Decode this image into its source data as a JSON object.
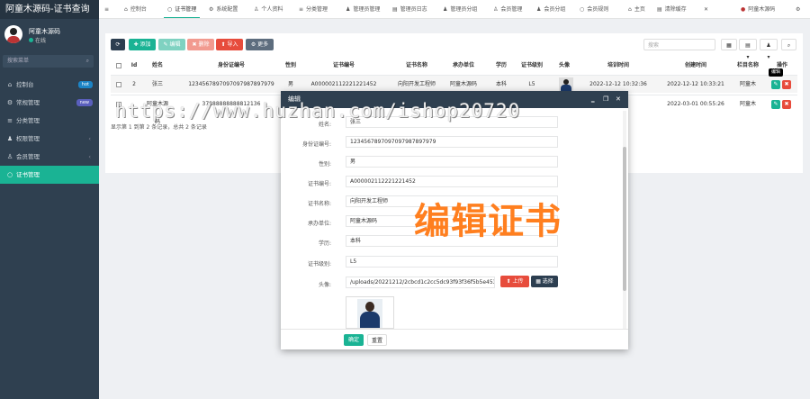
{
  "app_title": "阿童木源码-证书查询",
  "user": {
    "name": "阿童木源码",
    "status": "在线"
  },
  "sidebar": {
    "search_placeholder": "搜索菜单",
    "items": [
      {
        "label": "控制台",
        "icon": "⌂",
        "badge": "hot",
        "badge_color": "#1c84c6"
      },
      {
        "label": "常规管理",
        "icon": "⚙",
        "badge": "new",
        "badge_color": "#5a5fbd"
      },
      {
        "label": "分类管理",
        "icon": "≡"
      },
      {
        "label": "权限管理",
        "icon": "♟",
        "arrow": "‹"
      },
      {
        "label": "会员管理",
        "icon": "♙",
        "arrow": "‹"
      },
      {
        "label": "证书管理",
        "icon": "○"
      }
    ]
  },
  "topnav": [
    {
      "label": "",
      "icon": "≡"
    },
    {
      "label": "控制台",
      "icon": "⌂"
    },
    {
      "label": "证书管理",
      "icon": "○"
    },
    {
      "label": "系统配置",
      "icon": "⚙"
    },
    {
      "label": "个人资料",
      "icon": "♙"
    },
    {
      "label": "分类管理",
      "icon": "≡"
    },
    {
      "label": "管理员管理",
      "icon": "♟"
    },
    {
      "label": "管理员日志",
      "icon": "▤"
    },
    {
      "label": "管理员分组",
      "icon": "♟"
    },
    {
      "label": "会员管理",
      "icon": "♙"
    },
    {
      "label": "会员分组",
      "icon": "♟"
    },
    {
      "label": "会员规则",
      "icon": "○"
    },
    {
      "label": "主页",
      "icon": "⌂"
    },
    {
      "label": "清除缓存",
      "icon": "▤"
    },
    {
      "label": "",
      "icon": "✕"
    },
    {
      "label": "阿童木源码",
      "icon": "●"
    },
    {
      "label": "",
      "icon": "⚙"
    }
  ],
  "toolbar": {
    "refresh": "⟳",
    "add": "✚ 添加",
    "edit": "✎ 编辑",
    "delete": "✖ 删除",
    "import": "⬆ 导入",
    "more": "⚙ 更多",
    "search_placeholder": "搜索",
    "view_icons": [
      "▦",
      "▤ ▾",
      "♟ ▾",
      "⌕"
    ]
  },
  "table": {
    "headers": [
      "",
      "Id",
      "姓名",
      "身份证编号",
      "性别",
      "证书编号",
      "证书名称",
      "承办单位",
      "学历",
      "证书级别",
      "头像",
      "培训时间",
      "创建时间",
      "栏目名称",
      "操作"
    ],
    "rows": [
      {
        "id": "2",
        "name": "张三",
        "idno": "1234567897097097987897979",
        "gender": "男",
        "certno": "A000002112221221452",
        "certname": "向阳开发工程师",
        "org": "阿童木源码",
        "edu": "本科",
        "level": "L5",
        "train": "2022-12-12 10:32:36",
        "created": "2022-12-12 10:33:21",
        "column": "阿童木"
      },
      {
        "id": "",
        "name": "阿童木源码",
        "idno": "37888888888812136",
        "gender": "",
        "certno": "",
        "certname": "",
        "org": "",
        "edu": "",
        "level": "",
        "train": "",
        "created": "2022-03-01 00:55:26",
        "column": "阿童木"
      }
    ],
    "footer": "显示第 1 到第 2 条记录，总共 2 条记录",
    "tooltip": "编辑"
  },
  "modal": {
    "title": "编辑",
    "fields": [
      {
        "label": "姓名:",
        "value": "张三"
      },
      {
        "label": "身份证编号:",
        "value": "1234567897097097987897979"
      },
      {
        "label": "性别:",
        "value": "男"
      },
      {
        "label": "证书编号:",
        "value": "A000002112221221452"
      },
      {
        "label": "证书名称:",
        "value": "向阳开发工程师"
      },
      {
        "label": "承办单位:",
        "value": "阿童木源码"
      },
      {
        "label": "学历:",
        "value": "本科"
      },
      {
        "label": "证书级别:",
        "value": "L5"
      },
      {
        "label": "头像:",
        "value": "/uploads/20221212/2cbcd1c2cc5dc93f93f36f5b5e453dcf.jpg"
      }
    ],
    "upload": "⬆ 上传",
    "choose": "▦ 选择",
    "ok": "确定",
    "reset": "重置",
    "ctl": [
      "‗",
      "❐",
      "✕"
    ]
  },
  "watermark": "https://www.huzhan.com/ishop20720",
  "overlay_title": "编辑证书"
}
